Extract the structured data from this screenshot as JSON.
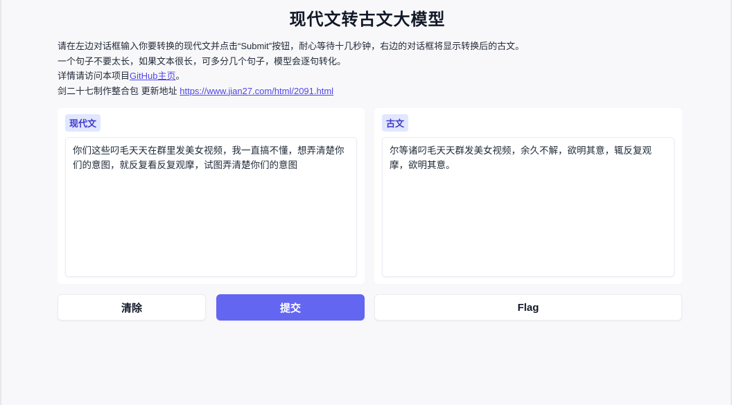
{
  "title": "现代文转古文大模型",
  "description": {
    "line1": "请在左边对话框输入你要转换的现代文并点击“Submit”按钮，耐心等待十几秒钟，右边的对话框将显示转换后的古文。",
    "line2": "一个句子不要太长，如果文本很长，可多分几个句子，模型会逐句转化。",
    "line3_prefix": "详情请访问本项目",
    "line3_link": "GitHub主页",
    "line3_suffix": "。",
    "line4_prefix": "剑二十七制作整合包 更新地址 ",
    "line4_link": "https://www.jian27.com/html/2091.html"
  },
  "input_panel": {
    "label": "现代文",
    "value": "你们这些叼毛天天在群里发美女视频，我一直搞不懂，想弄清楚你们的意图，就反复看反复观摩，试图弄清楚你们的意图"
  },
  "output_panel": {
    "label": "古文",
    "value": "尔等诸叼毛天天群发美女视频，余久不解，欲明其意，辄反复观摩，欲明其意。"
  },
  "buttons": {
    "clear": "清除",
    "submit": "提交",
    "flag": "Flag"
  },
  "colors": {
    "accent": "#6366f1",
    "label_bg": "#e0e7ff",
    "label_text": "#4338ca",
    "link": "#4f46e5"
  }
}
